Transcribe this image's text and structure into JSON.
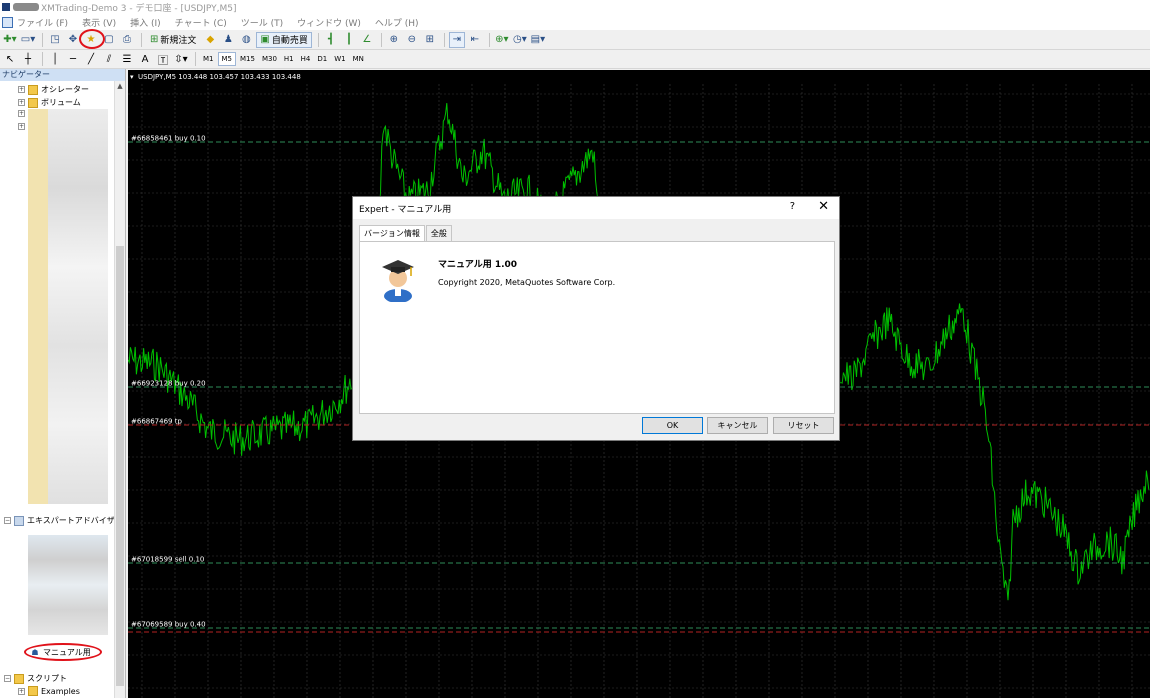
{
  "window": {
    "title": "XMTrading-Demo 3 - デモ口座 - [USDJPY,M5]"
  },
  "menu": [
    "ファイル (F)",
    "表示 (V)",
    "挿入 (I)",
    "チャート (C)",
    "ツール (T)",
    "ウィンドウ (W)",
    "ヘルプ (H)"
  ],
  "toolbar": {
    "new_order": "新規注文",
    "auto_trade": "自動売買",
    "timeframes": [
      "M1",
      "M5",
      "M15",
      "M30",
      "H1",
      "H4",
      "D1",
      "W1",
      "MN"
    ],
    "active_timeframe": "M5",
    "text_tool": "A"
  },
  "navigator": {
    "title": "ナビゲーター",
    "items": {
      "oscillators": "オシレーター",
      "volume": "ボリューム",
      "expert_advisors": "エキスパートアドバイザ",
      "manual_ea": "マニュアル用",
      "scripts": "スクリプト",
      "examples": "Examples"
    }
  },
  "chart": {
    "header": "USDJPY,M5  103.448 103.457 103.433 103.448",
    "order_labels": [
      "#66858461 buy 0.10",
      "#66923128 buy 0.20",
      "#66867469 tp",
      "#67018599 sell 0.10",
      "#67069589 buy 0.40"
    ],
    "colors": {
      "background": "#000000",
      "price_line": "#00c000",
      "grid": "#3a3a3a",
      "order_line": "#2e8b57",
      "tp_line": "#b22222"
    }
  },
  "dialog": {
    "title": "Expert - マニュアル用",
    "help": "?",
    "close": "✕",
    "tabs": [
      "バージョン情報",
      "全般"
    ],
    "ea_name": "マニュアル用 1.00",
    "copyright": "Copyright 2020, MetaQuotes Software Corp.",
    "buttons": {
      "ok": "OK",
      "cancel": "キャンセル",
      "reset": "リセット"
    }
  }
}
